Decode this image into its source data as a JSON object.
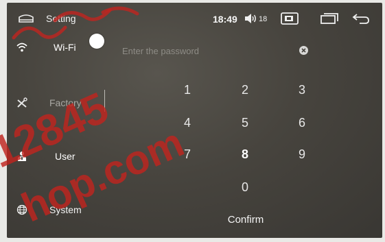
{
  "header": {
    "title": "Setting",
    "time": "18:49",
    "volume": "18",
    "icons": [
      "home-icon",
      "volume-icon",
      "dvr-icon",
      "recent-apps-icon",
      "back-icon"
    ]
  },
  "sidebar": {
    "items": [
      {
        "label": "Wi-Fi",
        "icon": "wifi-icon"
      },
      {
        "label": "Factory",
        "icon": "tools-icon"
      },
      {
        "label": "User",
        "icon": "user-icon"
      },
      {
        "label": "System",
        "icon": "globe-icon"
      }
    ]
  },
  "password": {
    "placeholder": "Enter the password",
    "value": ""
  },
  "keypad": {
    "keys": [
      "1",
      "2",
      "3",
      "4",
      "5",
      "6",
      "7",
      "8",
      "9",
      "0"
    ],
    "confirm_label": "Confirm"
  },
  "watermark": {
    "lines": [
      "12845",
      "hop.com"
    ],
    "color": "#c0241f"
  },
  "colors": {
    "screen_bg": "#47443e",
    "text": "#ffffff",
    "muted_text": "#a9a8a3",
    "watermark": "#c0241f"
  }
}
